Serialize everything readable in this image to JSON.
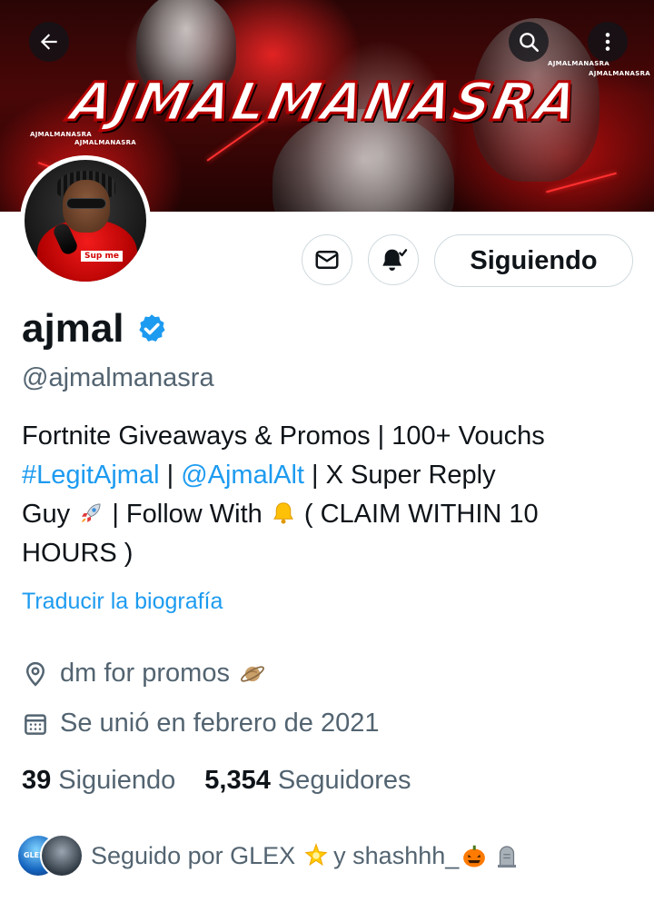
{
  "banner": {
    "title": "AJMALMANASRA",
    "tag_small_1": "AJMALMANASRA",
    "tag_small_2": "AJMALMANASRA",
    "tag_small_3": "AJMALMANASRA",
    "tag_small_4": "AJMALMANASRA"
  },
  "nav": {
    "back_icon": "arrow-left-icon",
    "search_icon": "search-icon",
    "more_icon": "more-vertical-icon"
  },
  "profile": {
    "display_name": "ajmal",
    "handle": "@ajmalmanasra",
    "verified_icon": "verified-badge-icon",
    "avatar_logo": "Sup me"
  },
  "actions": {
    "message_icon": "mail-icon",
    "notify_icon": "bell-check-icon",
    "follow_label": "Siguiendo"
  },
  "bio": {
    "line1": "Fortnite Giveaways & Promos | 100+ Vouchs",
    "hashtag": "#LegitAjmal",
    "sep1": " | ",
    "mention": "@AjmalAlt",
    "after_mention": " | X Super Reply",
    "guy": "Guy",
    "rocket_emoji": "rocket-emoji",
    "follow_with": " | Follow With ",
    "bell_emoji": "bell-emoji",
    "claim": " ( CLAIM WITHIN 10",
    "hours": "HOURS )"
  },
  "translate_label": "Traducir la biografía",
  "location": {
    "icon": "location-pin-icon",
    "text": "dm for promos",
    "emoji": "ringed-planet-emoji"
  },
  "joined": {
    "icon": "calendar-icon",
    "text": "Se unió en febrero de 2021"
  },
  "counts": {
    "following_num": "39",
    "following_label": "Siguiendo",
    "followers_num": "5,354",
    "followers_label": "Seguidores"
  },
  "followed_by": {
    "text_prefix": "Seguido por GLEX",
    "star_emoji": "glowing-star-emoji",
    "text_middle": " y shashhh_",
    "pumpkin_emoji": "jack-o-lantern-emoji",
    "headstone_emoji": "headstone-emoji",
    "avatar1_tag": "GLEX"
  },
  "colors": {
    "accent": "#1d9bf0",
    "text_primary": "#0f1419",
    "text_secondary": "#536471",
    "border": "#cfd9de",
    "banner_red": "#b80000"
  }
}
